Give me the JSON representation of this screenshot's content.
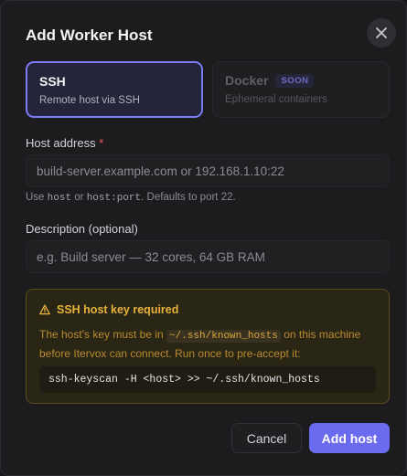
{
  "dialog": {
    "title": "Add Worker Host",
    "close_icon": "close-icon"
  },
  "host_types": [
    {
      "title": "SSH",
      "subtitle": "Remote host via SSH",
      "selected": true
    },
    {
      "title": "Docker",
      "subtitle": "Ephemeral containers",
      "badge": "SOON",
      "disabled": true
    }
  ],
  "host_address": {
    "label": "Host address",
    "required_marker": "*",
    "placeholder": "build-server.example.com or 192.168.1.10:22",
    "value": "",
    "hint_prefix": "Use",
    "hint_code_1": "host",
    "hint_or": "or",
    "hint_code_2": "host:port",
    "hint_suffix": ". Defaults to port 22."
  },
  "description": {
    "label": "Description (optional)",
    "placeholder": "e.g. Build server — 32 cores, 64 GB RAM",
    "value": ""
  },
  "ssh_warning": {
    "icon": "warning-icon",
    "title": "SSH host key required",
    "body_before": "The host's key must be in",
    "body_code": "~/.ssh/known_hosts",
    "body_after": "on this machine before Itervox can connect. Run once to pre-accept it:",
    "command": "ssh-keyscan -H <host> >> ~/.ssh/known_hosts"
  },
  "actions": {
    "cancel_label": "Cancel",
    "submit_label": "Add host"
  },
  "colors": {
    "accent": "#6b6bf0",
    "warning": "#e8b339",
    "required": "#ef5a5a"
  }
}
